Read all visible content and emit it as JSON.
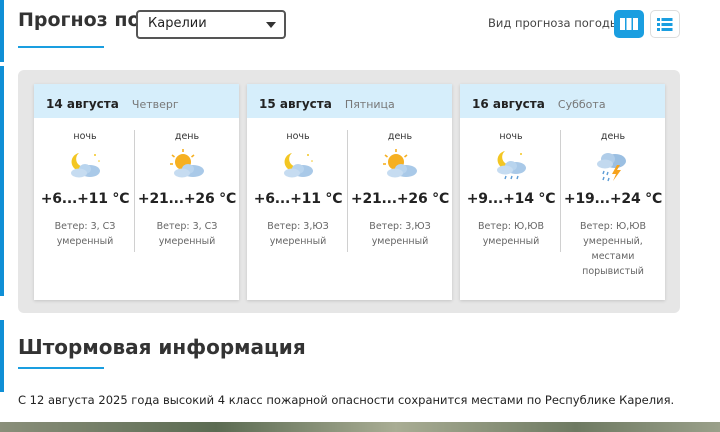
{
  "header": {
    "title": "Прогноз по",
    "region_selected": "Карелии",
    "view_label": "Вид прогноза погоды:",
    "view_options": [
      "cards-view-icon",
      "list-view-icon"
    ]
  },
  "days": [
    {
      "date": "14 августа",
      "weekday": "Четверг",
      "night": {
        "label": "ночь",
        "icon": "moon-cloud-icon",
        "temp": "+6...+11 °C",
        "wind1": "Ветер: 3, СЗ",
        "wind2": "умеренный",
        "wind3": "",
        "wind4": ""
      },
      "day": {
        "label": "день",
        "icon": "sun-cloud-icon",
        "temp": "+21...+26 °C",
        "wind1": "Ветер: 3, СЗ",
        "wind2": "умеренный",
        "wind3": "",
        "wind4": ""
      }
    },
    {
      "date": "15 августа",
      "weekday": "Пятница",
      "night": {
        "label": "ночь",
        "icon": "moon-cloud-icon",
        "temp": "+6...+11 °C",
        "wind1": "Ветер: 3,ЮЗ",
        "wind2": "умеренный",
        "wind3": "",
        "wind4": ""
      },
      "day": {
        "label": "день",
        "icon": "sun-cloud-icon",
        "temp": "+21...+26 °C",
        "wind1": "Ветер: 3,ЮЗ",
        "wind2": "умеренный",
        "wind3": "",
        "wind4": ""
      }
    },
    {
      "date": "16 августа",
      "weekday": "Суббота",
      "night": {
        "label": "ночь",
        "icon": "moon-cloud-rain-icon",
        "temp": "+9...+14 °C",
        "wind1": "Ветер: Ю,ЮВ",
        "wind2": "умеренный",
        "wind3": "",
        "wind4": ""
      },
      "day": {
        "label": "день",
        "icon": "thunderstorm-icon",
        "temp": "+19...+24 °C",
        "wind1": "Ветер: Ю,ЮВ",
        "wind2": "умеренный,",
        "wind3": "местами",
        "wind4": "порывистый"
      }
    }
  ],
  "storm": {
    "title": "Штормовая информация",
    "text": "С 12 августа 2025 года высокий 4 класс пожарной опасности сохранится местами по Республике Карелия."
  },
  "colors": {
    "accent": "#1a9ee0",
    "card_header": "#d6eefb",
    "panel_bg": "#e6e6e6"
  }
}
